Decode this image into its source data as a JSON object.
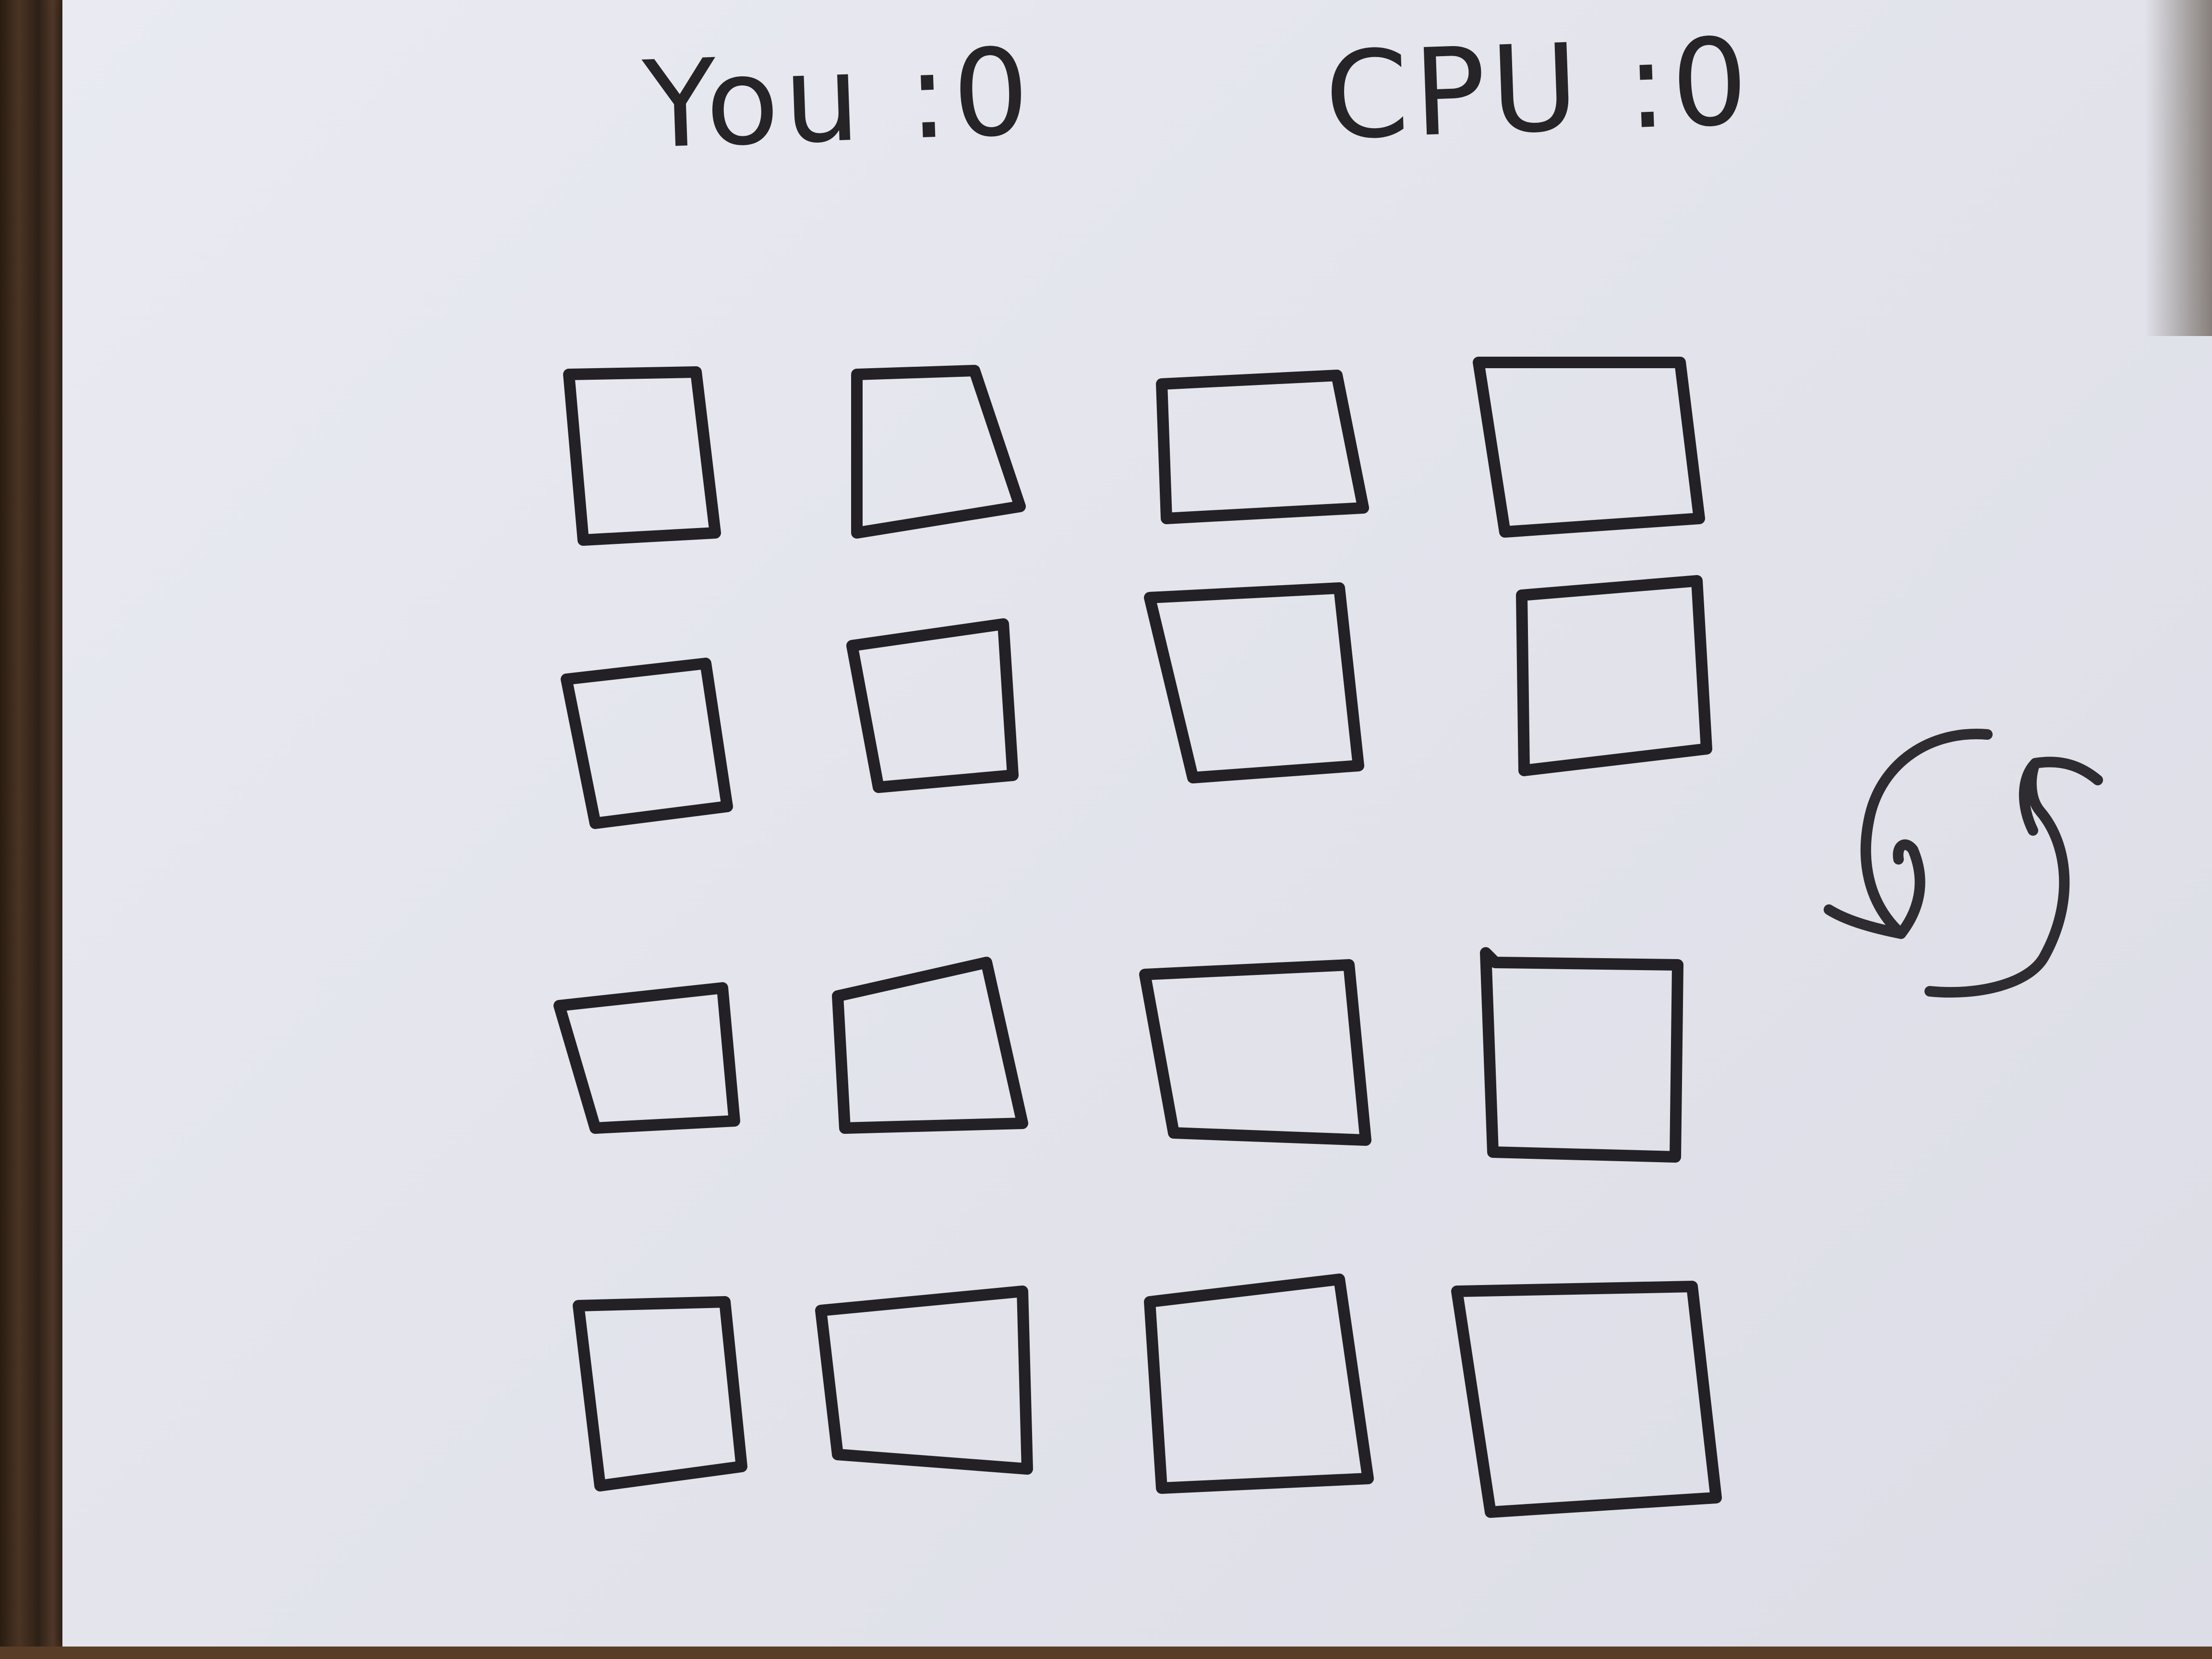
{
  "scoreboard": {
    "you_label": "You",
    "you_score": "0",
    "cpu_label": "CPU",
    "cpu_score": "0"
  },
  "board": {
    "rows": 4,
    "cols": 4,
    "cards_face_down": 16
  },
  "controls": {
    "restart_icon": "restart-icon"
  }
}
